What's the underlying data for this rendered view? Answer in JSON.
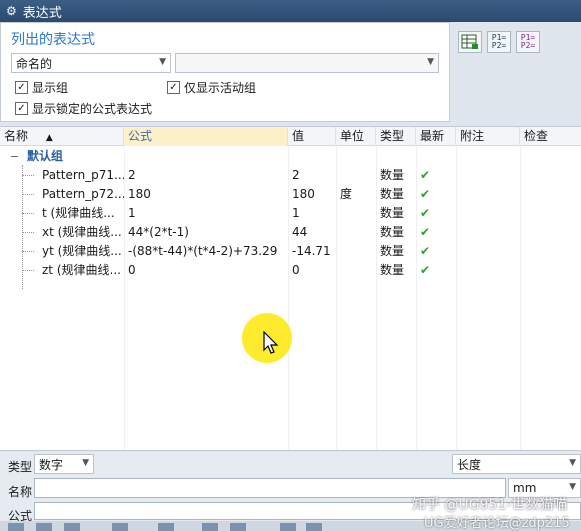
{
  "window": {
    "title": "表达式"
  },
  "listing": {
    "section_title": "列出的表达式",
    "filter_value": "命名的",
    "filter_text": "",
    "show_groups": "显示组",
    "show_active_only": "仅显示活动组",
    "show_locked": "显示锁定的公式表达式"
  },
  "toolbar": {
    "btn1_text": "",
    "btn2_text": "P1=\nP2=",
    "btn3_text": "P1=\nP2="
  },
  "table": {
    "headers": {
      "name": "名称",
      "sort_arrow": "▲",
      "formula": "公式",
      "value": "值",
      "unit": "单位",
      "type": "类型",
      "latest": "最新",
      "note": "附注",
      "check": "检查"
    },
    "group_label": "默认组",
    "rows": [
      {
        "name": "Pattern_p71...",
        "formula": "2",
        "value": "2",
        "unit": "",
        "type": "数量",
        "latest": "✔"
      },
      {
        "name": "Pattern_p72...",
        "formula": "180",
        "value": "180",
        "unit": "度",
        "type": "数量",
        "latest": "✔"
      },
      {
        "name": "t (规律曲线...",
        "formula": "1",
        "value": "1",
        "unit": "",
        "type": "数量",
        "latest": "✔"
      },
      {
        "name": "xt (规律曲线...",
        "formula": "44*(2*t-1)",
        "value": "44",
        "unit": "",
        "type": "数量",
        "latest": "✔"
      },
      {
        "name": "yt (规律曲线...",
        "formula": "-(88*t-44)*(t*4-2)+73.29",
        "value": "-14.71",
        "unit": "",
        "type": "数量",
        "latest": "✔"
      },
      {
        "name": "zt (规律曲线...",
        "formula": "0",
        "value": "0",
        "unit": "",
        "type": "数量",
        "latest": "✔"
      }
    ]
  },
  "bottom": {
    "type_label": "类型",
    "type_value": "数字",
    "dimension_value": "长度",
    "name_label": "名称",
    "name_value": "",
    "unit_value": "mm",
    "formula_label": "公式"
  },
  "watermark": {
    "line1": "知乎 @UG951-世数猫喵",
    "line2": "UG爱好者论坛@zdp215"
  }
}
